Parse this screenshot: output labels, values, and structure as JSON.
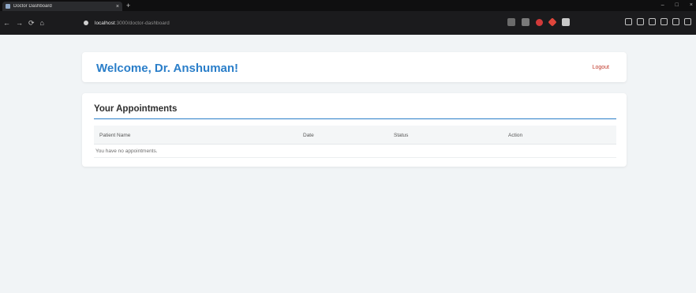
{
  "browser": {
    "tab_title": "Doctor Dashboard",
    "tab_close": "×",
    "new_tab": "+",
    "window_controls": [
      "–",
      "□",
      "×"
    ],
    "nav_icons": [
      "←",
      "→",
      "⟳",
      "⌂"
    ],
    "url_host": "localhost",
    "url_path": ":3000/doctor-dashboard"
  },
  "header": {
    "welcome": "Welcome, Dr. Anshuman!",
    "logout": "Logout"
  },
  "appointments": {
    "title": "Your Appointments",
    "columns": [
      "Patient Name",
      "Date",
      "Status",
      "Action"
    ],
    "empty_message": "You have no appointments."
  },
  "colors": {
    "accent": "#2a7ec9",
    "logout": "#c0392b",
    "background": "#f1f4f6"
  }
}
